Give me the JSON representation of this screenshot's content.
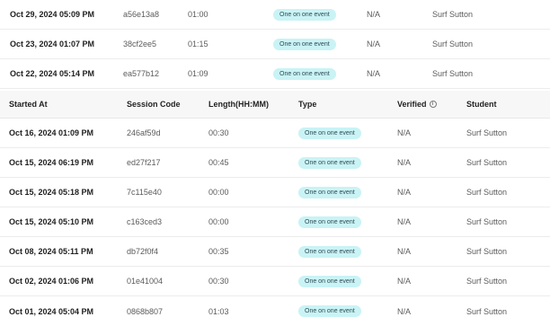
{
  "colors": {
    "badge_bg": "#c9f3f5",
    "header_bg": "#f7f7f8"
  },
  "header": {
    "started_at": "Started At",
    "session_code": "Session Code",
    "length": "Length(HH:MM)",
    "type": "Type",
    "verified": "Verified",
    "verified_icon": "info-icon",
    "student": "Student"
  },
  "top_rows": [
    {
      "started_at": "Oct 29, 2024 05:09 PM",
      "session_code": "a56e13a8",
      "length": "01:00",
      "type": "One on one event",
      "verified": "N/A",
      "student": "Surf Sutton"
    },
    {
      "started_at": "Oct 23, 2024 01:07 PM",
      "session_code": "38cf2ee5",
      "length": "01:15",
      "type": "One on one event",
      "verified": "N/A",
      "student": "Surf Sutton"
    },
    {
      "started_at": "Oct 22, 2024 05:14 PM",
      "session_code": "ea577b12",
      "length": "01:09",
      "type": "One on one event",
      "verified": "N/A",
      "student": "Surf Sutton"
    }
  ],
  "rows": [
    {
      "started_at": "Oct 16, 2024 01:09 PM",
      "session_code": "246af59d",
      "length": "00:30",
      "type": "One on one event",
      "verified": "N/A",
      "student": "Surf Sutton"
    },
    {
      "started_at": "Oct 15, 2024 06:19 PM",
      "session_code": "ed27f217",
      "length": "00:45",
      "type": "One on one event",
      "verified": "N/A",
      "student": "Surf Sutton"
    },
    {
      "started_at": "Oct 15, 2024 05:18 PM",
      "session_code": "7c115e40",
      "length": "00:00",
      "type": "One on one event",
      "verified": "N/A",
      "student": "Surf Sutton"
    },
    {
      "started_at": "Oct 15, 2024 05:10 PM",
      "session_code": "c163ced3",
      "length": "00:00",
      "type": "One on one event",
      "verified": "N/A",
      "student": "Surf Sutton"
    },
    {
      "started_at": "Oct 08, 2024 05:11 PM",
      "session_code": "db72f0f4",
      "length": "00:35",
      "type": "One on one event",
      "verified": "N/A",
      "student": "Surf Sutton"
    },
    {
      "started_at": "Oct 02, 2024 01:06 PM",
      "session_code": "01e41004",
      "length": "00:30",
      "type": "One on one event",
      "verified": "N/A",
      "student": "Surf Sutton"
    },
    {
      "started_at": "Oct 01, 2024 05:04 PM",
      "session_code": "0868b807",
      "length": "01:03",
      "type": "One on one event",
      "verified": "N/A",
      "student": "Surf Sutton"
    }
  ]
}
